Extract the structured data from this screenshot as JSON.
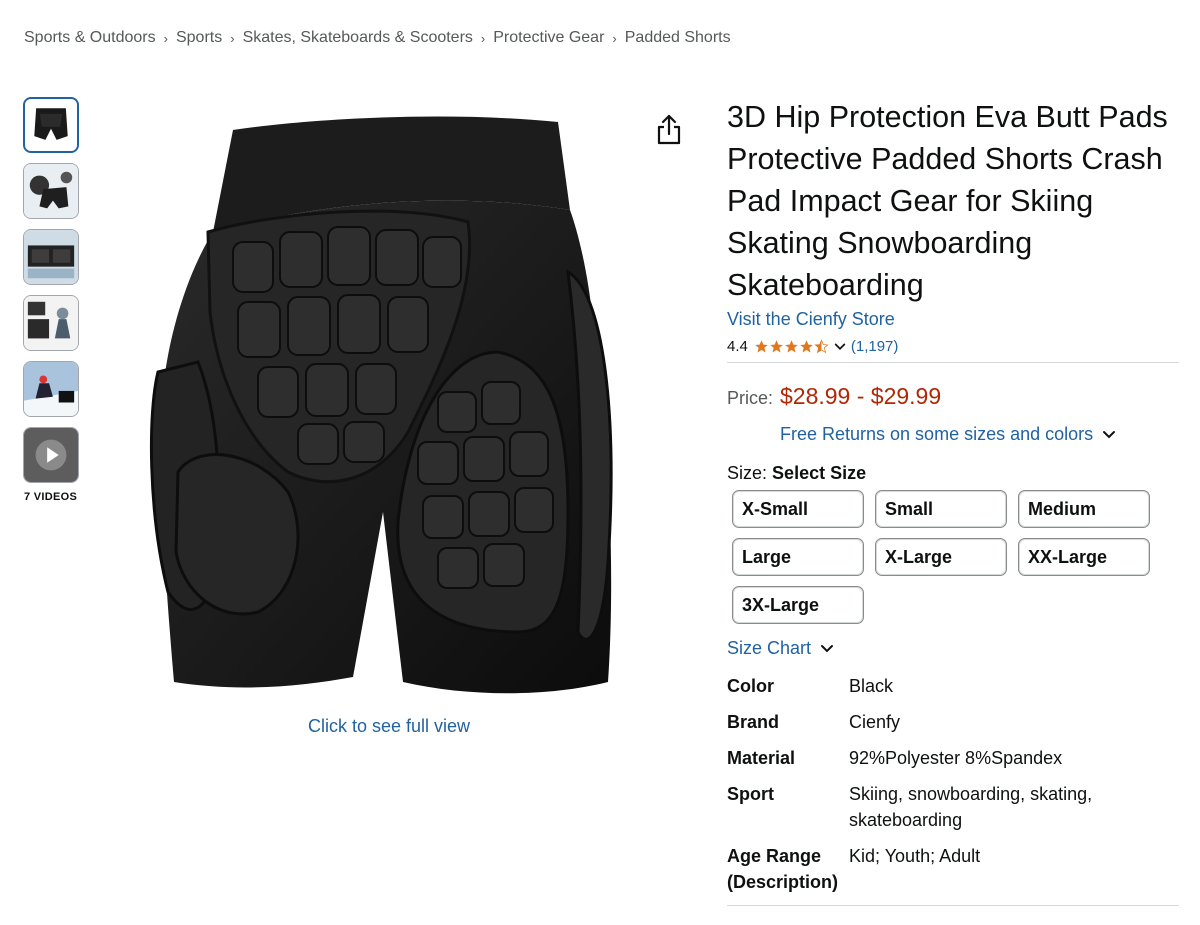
{
  "breadcrumb": [
    "Sports & Outdoors",
    "Sports",
    "Skates, Skateboards & Scooters",
    "Protective Gear",
    "Padded Shorts"
  ],
  "breadcrumb_separator": "›",
  "gallery": {
    "videos_label": "7 VIDEOS",
    "full_view_label": "Click to see full view"
  },
  "product": {
    "title": "3D Hip Protection Eva Butt Pads Protective Padded Shorts Crash Pad Impact Gear for Skiing Skating Snowboarding Skateboarding",
    "store_link": "Visit the Cienfy Store",
    "rating": "4.4",
    "rating_value": 4.4,
    "rating_count": "(1,197)",
    "price_label": "Price:",
    "price": "$28.99 - $29.99",
    "returns_label": "Free Returns on some sizes and colors",
    "size_key": "Size:",
    "size_value": "Select Size",
    "sizes": [
      "X-Small",
      "Small",
      "Medium",
      "Large",
      "X-Large",
      "XX-Large",
      "3X-Large"
    ],
    "size_chart_label": "Size Chart"
  },
  "specs": [
    {
      "key": "Color",
      "value": "Black"
    },
    {
      "key": "Brand",
      "value": "Cienfy"
    },
    {
      "key": "Material",
      "value": "92%Polyester 8%Spandex"
    },
    {
      "key": "Sport",
      "value": "Skiing, snowboarding, skating, skateboarding"
    },
    {
      "key": "Age Range (Description)",
      "value": "Kid; Youth; Adult"
    }
  ],
  "colors": {
    "link": "#2162a1",
    "price": "#b12704",
    "star": "#de7921"
  }
}
